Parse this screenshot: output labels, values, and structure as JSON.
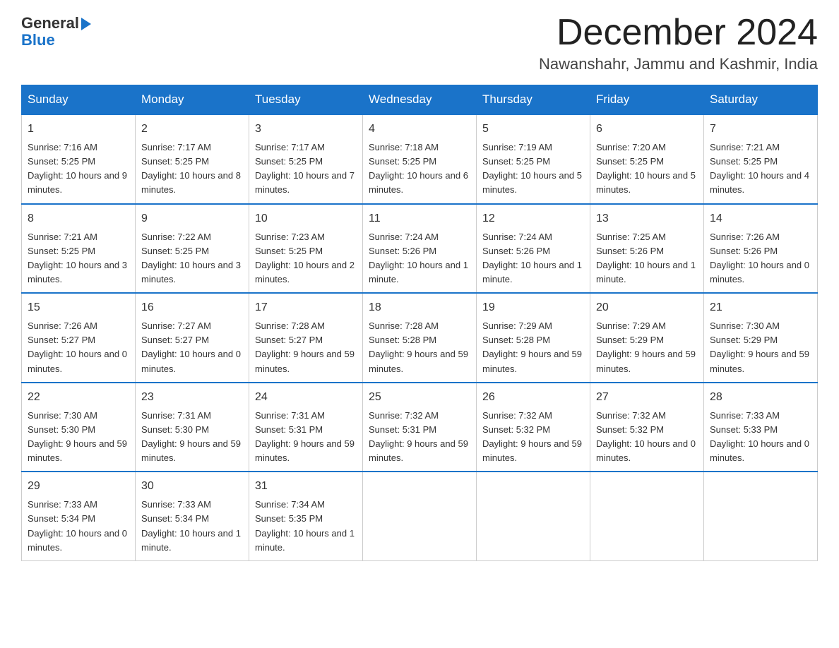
{
  "logo": {
    "general": "General",
    "blue": "Blue",
    "triangle_char": "▶"
  },
  "title": "December 2024",
  "location": "Nawanshahr, Jammu and Kashmir, India",
  "days_of_week": [
    "Sunday",
    "Monday",
    "Tuesday",
    "Wednesday",
    "Thursday",
    "Friday",
    "Saturday"
  ],
  "weeks": [
    [
      {
        "day": "1",
        "sunrise": "7:16 AM",
        "sunset": "5:25 PM",
        "daylight": "10 hours and 9 minutes."
      },
      {
        "day": "2",
        "sunrise": "7:17 AM",
        "sunset": "5:25 PM",
        "daylight": "10 hours and 8 minutes."
      },
      {
        "day": "3",
        "sunrise": "7:17 AM",
        "sunset": "5:25 PM",
        "daylight": "10 hours and 7 minutes."
      },
      {
        "day": "4",
        "sunrise": "7:18 AM",
        "sunset": "5:25 PM",
        "daylight": "10 hours and 6 minutes."
      },
      {
        "day": "5",
        "sunrise": "7:19 AM",
        "sunset": "5:25 PM",
        "daylight": "10 hours and 5 minutes."
      },
      {
        "day": "6",
        "sunrise": "7:20 AM",
        "sunset": "5:25 PM",
        "daylight": "10 hours and 5 minutes."
      },
      {
        "day": "7",
        "sunrise": "7:21 AM",
        "sunset": "5:25 PM",
        "daylight": "10 hours and 4 minutes."
      }
    ],
    [
      {
        "day": "8",
        "sunrise": "7:21 AM",
        "sunset": "5:25 PM",
        "daylight": "10 hours and 3 minutes."
      },
      {
        "day": "9",
        "sunrise": "7:22 AM",
        "sunset": "5:25 PM",
        "daylight": "10 hours and 3 minutes."
      },
      {
        "day": "10",
        "sunrise": "7:23 AM",
        "sunset": "5:25 PM",
        "daylight": "10 hours and 2 minutes."
      },
      {
        "day": "11",
        "sunrise": "7:24 AM",
        "sunset": "5:26 PM",
        "daylight": "10 hours and 1 minute."
      },
      {
        "day": "12",
        "sunrise": "7:24 AM",
        "sunset": "5:26 PM",
        "daylight": "10 hours and 1 minute."
      },
      {
        "day": "13",
        "sunrise": "7:25 AM",
        "sunset": "5:26 PM",
        "daylight": "10 hours and 1 minute."
      },
      {
        "day": "14",
        "sunrise": "7:26 AM",
        "sunset": "5:26 PM",
        "daylight": "10 hours and 0 minutes."
      }
    ],
    [
      {
        "day": "15",
        "sunrise": "7:26 AM",
        "sunset": "5:27 PM",
        "daylight": "10 hours and 0 minutes."
      },
      {
        "day": "16",
        "sunrise": "7:27 AM",
        "sunset": "5:27 PM",
        "daylight": "10 hours and 0 minutes."
      },
      {
        "day": "17",
        "sunrise": "7:28 AM",
        "sunset": "5:27 PM",
        "daylight": "9 hours and 59 minutes."
      },
      {
        "day": "18",
        "sunrise": "7:28 AM",
        "sunset": "5:28 PM",
        "daylight": "9 hours and 59 minutes."
      },
      {
        "day": "19",
        "sunrise": "7:29 AM",
        "sunset": "5:28 PM",
        "daylight": "9 hours and 59 minutes."
      },
      {
        "day": "20",
        "sunrise": "7:29 AM",
        "sunset": "5:29 PM",
        "daylight": "9 hours and 59 minutes."
      },
      {
        "day": "21",
        "sunrise": "7:30 AM",
        "sunset": "5:29 PM",
        "daylight": "9 hours and 59 minutes."
      }
    ],
    [
      {
        "day": "22",
        "sunrise": "7:30 AM",
        "sunset": "5:30 PM",
        "daylight": "9 hours and 59 minutes."
      },
      {
        "day": "23",
        "sunrise": "7:31 AM",
        "sunset": "5:30 PM",
        "daylight": "9 hours and 59 minutes."
      },
      {
        "day": "24",
        "sunrise": "7:31 AM",
        "sunset": "5:31 PM",
        "daylight": "9 hours and 59 minutes."
      },
      {
        "day": "25",
        "sunrise": "7:32 AM",
        "sunset": "5:31 PM",
        "daylight": "9 hours and 59 minutes."
      },
      {
        "day": "26",
        "sunrise": "7:32 AM",
        "sunset": "5:32 PM",
        "daylight": "9 hours and 59 minutes."
      },
      {
        "day": "27",
        "sunrise": "7:32 AM",
        "sunset": "5:32 PM",
        "daylight": "10 hours and 0 minutes."
      },
      {
        "day": "28",
        "sunrise": "7:33 AM",
        "sunset": "5:33 PM",
        "daylight": "10 hours and 0 minutes."
      }
    ],
    [
      {
        "day": "29",
        "sunrise": "7:33 AM",
        "sunset": "5:34 PM",
        "daylight": "10 hours and 0 minutes."
      },
      {
        "day": "30",
        "sunrise": "7:33 AM",
        "sunset": "5:34 PM",
        "daylight": "10 hours and 1 minute."
      },
      {
        "day": "31",
        "sunrise": "7:34 AM",
        "sunset": "5:35 PM",
        "daylight": "10 hours and 1 minute."
      },
      null,
      null,
      null,
      null
    ]
  ]
}
